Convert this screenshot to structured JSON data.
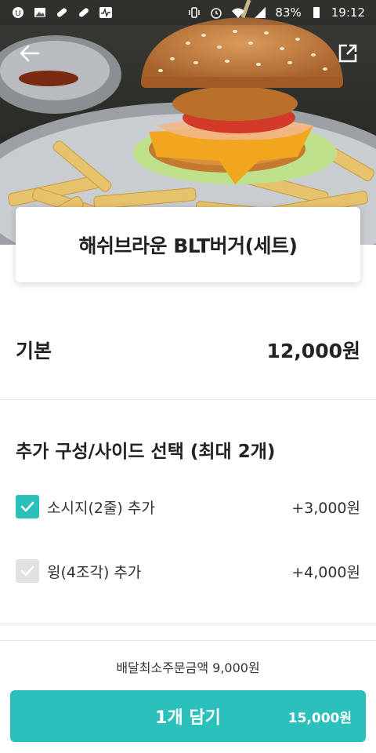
{
  "status_bar": {
    "battery": "83%",
    "time": "19:12",
    "left_icons": [
      "u-plus-icon",
      "gallery-icon",
      "pill-icon",
      "pill-icon",
      "activity-icon"
    ],
    "right_icons": [
      "vibrate-icon",
      "alarm-icon",
      "wifi-icon",
      "signal-icon",
      "battery-icon"
    ]
  },
  "hero": {
    "image": "burger-photo",
    "back_icon": "back-arrow-icon",
    "share_icon": "share-icon"
  },
  "product": {
    "name": "해쉬브라운 BLT버거(세트)"
  },
  "base": {
    "label": "기본",
    "price": "12,000원"
  },
  "options": {
    "title": "추가 구성/사이드 선택 (최대 2개)",
    "items": [
      {
        "label": "소시지(2줄) 추가",
        "price": "+3,000원",
        "checked": true
      },
      {
        "label": "윙(4조각) 추가",
        "price": "+4,000원",
        "checked": false
      }
    ]
  },
  "footer": {
    "min_order": "배달최소주문금액 9,000원",
    "cart_label": "1개 담기",
    "cart_total": "15,000원"
  },
  "colors": {
    "accent": "#2bc0bb",
    "checkbox_off": "#e1e1e1"
  }
}
